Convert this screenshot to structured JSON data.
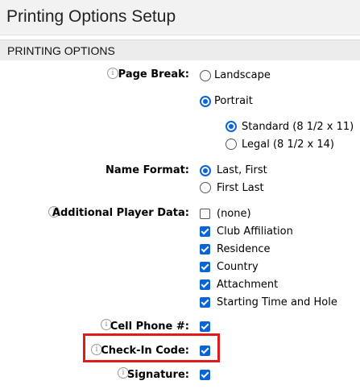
{
  "window": {
    "title": "Printing Options Setup"
  },
  "section": {
    "title": "PRINTING OPTIONS"
  },
  "icons": {
    "info": "info-circle-icon",
    "info_glyph": "i"
  },
  "page_break": {
    "label": "Page Break:",
    "options": {
      "landscape": "Landscape",
      "portrait": "Portrait"
    },
    "selected": "Portrait",
    "paper": {
      "standard": "Standard (8 1/2 x 11)",
      "legal": "Legal (8 1/2 x 14)",
      "selected": "Standard (8 1/2 x 11)"
    }
  },
  "name_format": {
    "label": "Name Format:",
    "options": {
      "last_first": "Last, First",
      "first_last": "First Last"
    },
    "selected": "Last, First"
  },
  "additional_player_data": {
    "label": "Additional Player Data:",
    "items": {
      "none": "(none)",
      "club_affiliation": "Club Affiliation",
      "residence": "Residence",
      "country": "Country",
      "attachment": "Attachment",
      "starting_time": "Starting Time and Hole"
    },
    "checked": [
      "Club Affiliation",
      "Residence",
      "Country",
      "Attachment",
      "Starting Time and Hole"
    ]
  },
  "cell_phone": {
    "label": "Cell Phone #:",
    "checked": true
  },
  "check_in_code": {
    "label": "Check-In Code:",
    "checked": true
  },
  "signature": {
    "label": "Signature:",
    "checked": true
  },
  "colors": {
    "accent": "#0a64d8",
    "highlight_border": "#e01b1b"
  }
}
